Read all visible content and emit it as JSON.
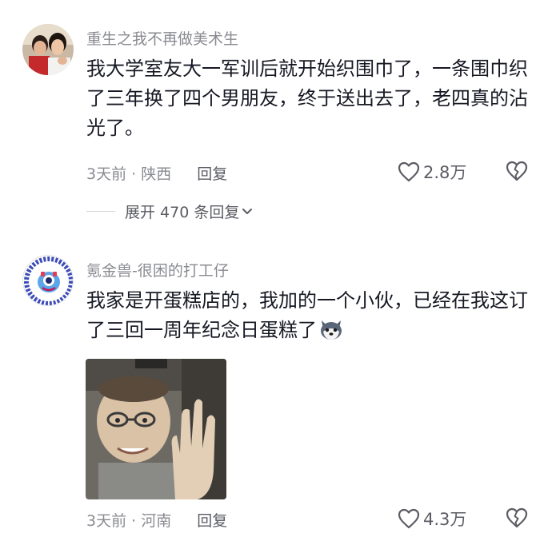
{
  "comments": [
    {
      "username": "重生之我不再做美术生",
      "text": "我大学室友大一军训后就开始织围巾了，一条围巾织了三年换了四个男朋友，终于送出去了，老四真的沾光了。",
      "time": "3天前",
      "dot": "·",
      "location": "陕西",
      "reply_label": "回复",
      "likes": "2.8万",
      "expand_label": "展开 470 条回复"
    },
    {
      "username": "氪金兽-很困的打工仔",
      "text": "我家是开蛋糕店的，我加的一个小伙，已经在我这订了三回一周年纪念日蛋糕了",
      "time": "3天前",
      "dot": "·",
      "location": "河南",
      "reply_label": "回复",
      "likes": "4.3万"
    }
  ],
  "colors": {
    "primary_text": "#161823",
    "secondary_text": "#8a8b91",
    "action_text": "#5b5c63",
    "background": "#ffffff"
  },
  "icons": {
    "like": "heart-outline-icon",
    "dislike": "broken-heart-icon",
    "expand": "chevron-down-icon",
    "emoji": "husky-emoji-icon"
  }
}
